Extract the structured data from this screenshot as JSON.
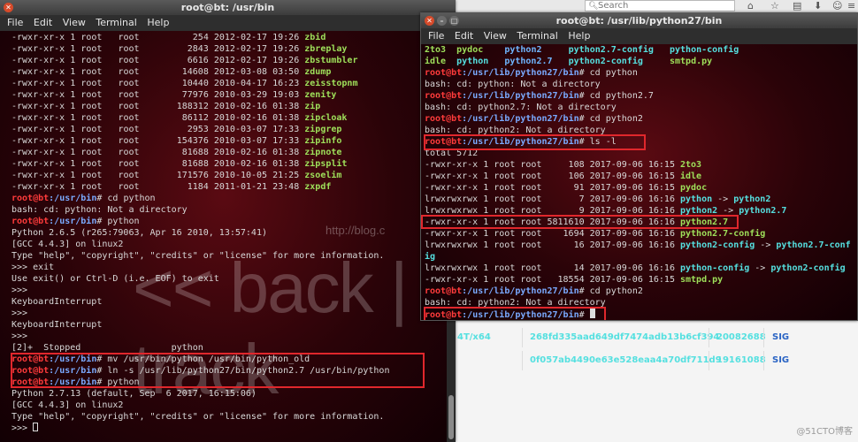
{
  "browser": {
    "search_placeholder": "Search",
    "icons": [
      "home-icon",
      "star-icon",
      "clipboard-icon",
      "download-icon",
      "person-icon",
      "menu-icon"
    ]
  },
  "web_table": {
    "rows": [
      {
        "platform": "4T/x64",
        "hash": "268fd335aad649df7474adb13b6cf394",
        "size": "20082688",
        "sig": "SIG"
      },
      {
        "platform": "",
        "hash": "0f057ab4490e63e528eaa4a70df711d9",
        "size": "19161088",
        "sig": "SIG"
      }
    ],
    "watermark": "@51CTO博客"
  },
  "left_terminal": {
    "title": "root@bt: /usr/bin",
    "menu": [
      "File",
      "Edit",
      "View",
      "Terminal",
      "Help"
    ],
    "listing": [
      {
        "perm": "-rwxr-xr-x",
        "links": "1",
        "user": "root",
        "group": "root",
        "size": "254",
        "date": "2012-02-17",
        "time": "19:26",
        "name": "zbid"
      },
      {
        "perm": "-rwxr-xr-x",
        "links": "1",
        "user": "root",
        "group": "root",
        "size": "2843",
        "date": "2012-02-17",
        "time": "19:26",
        "name": "zbreplay"
      },
      {
        "perm": "-rwxr-xr-x",
        "links": "1",
        "user": "root",
        "group": "root",
        "size": "6616",
        "date": "2012-02-17",
        "time": "19:26",
        "name": "zbstumbler"
      },
      {
        "perm": "-rwxr-xr-x",
        "links": "1",
        "user": "root",
        "group": "root",
        "size": "14608",
        "date": "2012-03-08",
        "time": "03:50",
        "name": "zdump"
      },
      {
        "perm": "-rwxr-xr-x",
        "links": "1",
        "user": "root",
        "group": "root",
        "size": "10440",
        "date": "2010-04-17",
        "time": "16:23",
        "name": "zeisstopnm"
      },
      {
        "perm": "-rwxr-xr-x",
        "links": "1",
        "user": "root",
        "group": "root",
        "size": "77976",
        "date": "2010-03-29",
        "time": "19:03",
        "name": "zenity"
      },
      {
        "perm": "-rwxr-xr-x",
        "links": "1",
        "user": "root",
        "group": "root",
        "size": "188312",
        "date": "2010-02-16",
        "time": "01:38",
        "name": "zip"
      },
      {
        "perm": "-rwxr-xr-x",
        "links": "1",
        "user": "root",
        "group": "root",
        "size": "86112",
        "date": "2010-02-16",
        "time": "01:38",
        "name": "zipcloak"
      },
      {
        "perm": "-rwxr-xr-x",
        "links": "1",
        "user": "root",
        "group": "root",
        "size": "2953",
        "date": "2010-03-07",
        "time": "17:33",
        "name": "zipgrep"
      },
      {
        "perm": "-rwxr-xr-x",
        "links": "1",
        "user": "root",
        "group": "root",
        "size": "154376",
        "date": "2010-03-07",
        "time": "17:33",
        "name": "zipinfo"
      },
      {
        "perm": "-rwxr-xr-x",
        "links": "1",
        "user": "root",
        "group": "root",
        "size": "81688",
        "date": "2010-02-16",
        "time": "01:38",
        "name": "zipnote"
      },
      {
        "perm": "-rwxr-xr-x",
        "links": "1",
        "user": "root",
        "group": "root",
        "size": "81688",
        "date": "2010-02-16",
        "time": "01:38",
        "name": "zipsplit"
      },
      {
        "perm": "-rwxr-xr-x",
        "links": "1",
        "user": "root",
        "group": "root",
        "size": "171576",
        "date": "2010-10-05",
        "time": "21:25",
        "name": "zsoelim"
      },
      {
        "perm": "-rwxr-xr-x",
        "links": "1",
        "user": "root",
        "group": "root",
        "size": "1184",
        "date": "2011-01-21",
        "time": "23:48",
        "name": "zxpdf"
      }
    ],
    "prompt_user": "root@bt",
    "prompt_path": ":/usr/bin",
    "prompt_sym": "# ",
    "cmd_cd_python": "cd python",
    "out_not_dir": "bash: cd: python: Not a directory",
    "cmd_python": "python",
    "py265_version": "Python 2.6.5 (r265:79063, Apr 16 2010, 13:57:41)",
    "gcc": "[GCC 4.4.3] on linux2",
    "help_line": "Type \"help\", \"copyright\", \"credits\" or \"license\" for more information.",
    "repl_exit": ">>> exit",
    "exit_hint": "Use exit() or Ctrl-D (i.e. EOF) to exit",
    "repl_prompt": ">>>",
    "kbd_int": "KeyboardInterrupt",
    "stopped": "[2]+  Stopped                 python",
    "cmd_mv": "mv /usr/bin/python /usr/bin/python_old",
    "cmd_ln": "ln -s /usr/lib/python27/bin/python2.7 /usr/bin/python",
    "py2713_version": "Python 2.7.13 (default, Sep  6 2017, 16:15:06)",
    "final_prompt": ">>> ",
    "logo": "<< back | track",
    "logo_url": "http://blog.c"
  },
  "right_terminal": {
    "title": "root@bt: /usr/lib/python27/bin",
    "menu": [
      "File",
      "Edit",
      "View",
      "Terminal",
      "Help"
    ],
    "files_row1": [
      "2to3",
      "pydoc",
      "python2",
      "python2.7-config",
      "python-config"
    ],
    "files_row2": [
      "idle",
      "python",
      "python2.7",
      "python2-config",
      "smtpd.py"
    ],
    "prompt_user": "root@bt",
    "prompt_path": ":/usr/lib/python27/bin",
    "prompt_sym": "# ",
    "cmd_cd_python": "cd python",
    "out_python": "bash: cd: python: Not a directory",
    "cmd_cd_python27": "cd python2.7",
    "out_python27": "bash: cd: python2.7: Not a directory",
    "cmd_cd_python2": "cd python2",
    "out_python2": "bash: cd: python2: Not a directory",
    "cmd_ls": "ls -l",
    "total": "total 5712",
    "listing": [
      {
        "meta": "-rwxr-xr-x 1 root root     108 2017-09-06 16:15 ",
        "name": "2to3",
        "target": ""
      },
      {
        "meta": "-rwxr-xr-x 1 root root     106 2017-09-06 16:15 ",
        "name": "idle",
        "target": ""
      },
      {
        "meta": "-rwxr-xr-x 1 root root      91 2017-09-06 16:15 ",
        "name": "pydoc",
        "target": ""
      },
      {
        "meta": "lrwxrwxrwx 1 root root       7 2017-09-06 16:16 ",
        "name": "python",
        "target": "python2"
      },
      {
        "meta": "lrwxrwxrwx 1 root root       9 2017-09-06 16:16 ",
        "name": "python2",
        "target": "python2.7"
      },
      {
        "meta": "-rwxr-xr-x 1 root root 5811610 2017-09-06 16:16 ",
        "name": "python2.7",
        "target": ""
      },
      {
        "meta": "-rwxr-xr-x 1 root root    1694 2017-09-06 16:16 ",
        "name": "python2.7-config",
        "target": ""
      },
      {
        "meta": "lrwxrwxrwx 1 root root      16 2017-09-06 16:16 ",
        "name": "python2-config",
        "target": "python2.7-conf"
      },
      {
        "meta": "",
        "name": "",
        "target": "ig"
      },
      {
        "meta": "lrwxrwxrwx 1 root root      14 2017-09-06 16:16 ",
        "name": "python-config",
        "target": "python2-config"
      },
      {
        "meta": "-rwxr-xr-x 1 root root   18554 2017-09-06 16:15 ",
        "name": "smtpd.py",
        "target": ""
      }
    ],
    "arrow": " -> "
  }
}
